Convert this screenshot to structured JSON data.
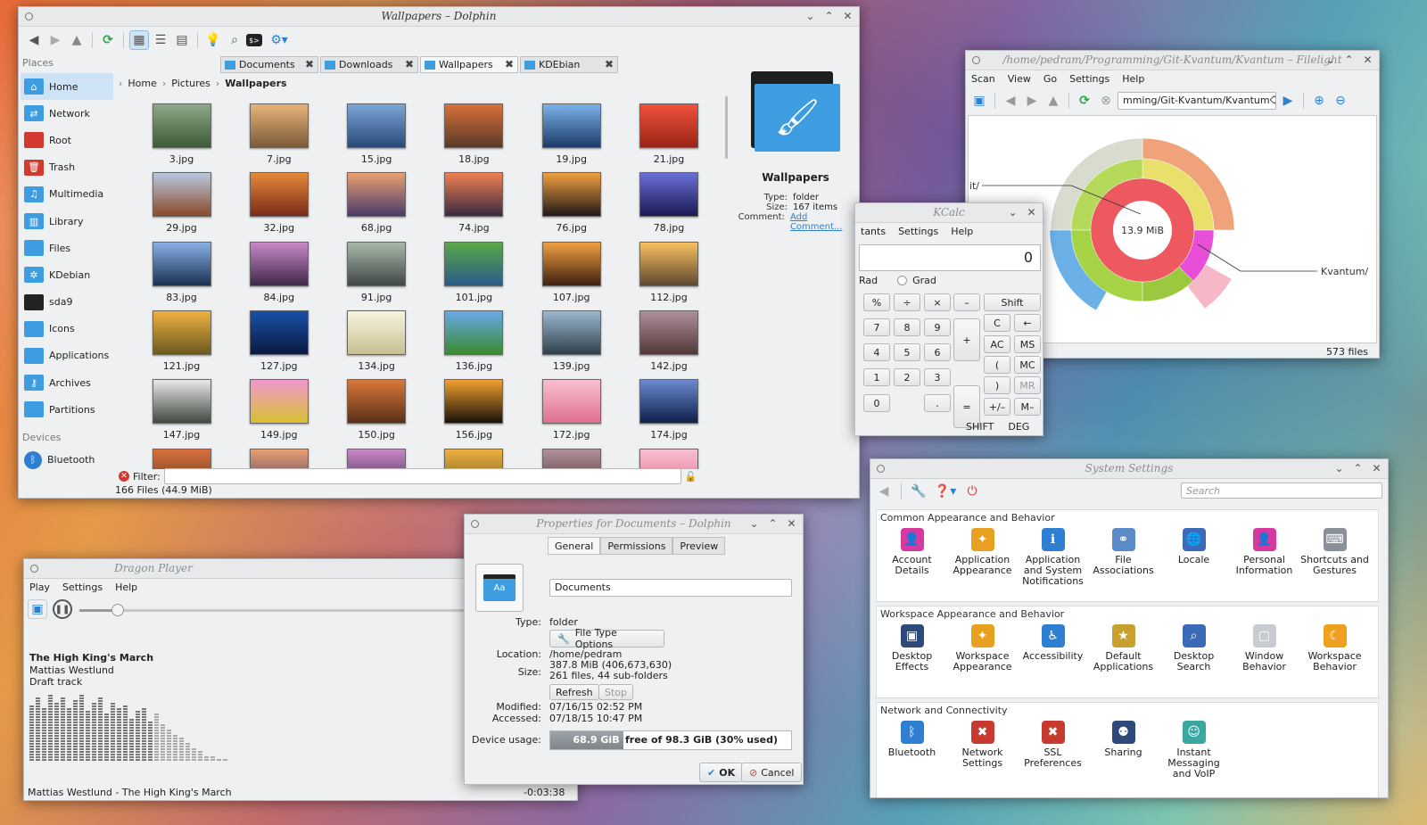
{
  "dolphin": {
    "title": "Wallpapers – Dolphin",
    "places_header": "Places",
    "devices_header": "Devices",
    "places": [
      "Home",
      "Network",
      "Root",
      "Trash",
      "Multimedia",
      "Library",
      "Files",
      "KDebian",
      "sda9",
      "Icons",
      "Applications",
      "Archives",
      "Partitions"
    ],
    "devices": [
      "Bluetooth"
    ],
    "tabs": [
      "Documents",
      "Downloads",
      "Wallpapers",
      "KDEbian"
    ],
    "breadcrumb": [
      "Home",
      "Pictures",
      "Wallpapers"
    ],
    "files": [
      "3.jpg",
      "7.jpg",
      "15.jpg",
      "18.jpg",
      "19.jpg",
      "21.jpg",
      "29.jpg",
      "32.jpg",
      "68.jpg",
      "74.jpg",
      "76.jpg",
      "78.jpg",
      "83.jpg",
      "84.jpg",
      "91.jpg",
      "101.jpg",
      "107.jpg",
      "112.jpg",
      "121.jpg",
      "127.jpg",
      "134.jpg",
      "136.jpg",
      "139.jpg",
      "142.jpg",
      "147.jpg",
      "149.jpg",
      "150.jpg",
      "156.jpg",
      "172.jpg",
      "174.jpg"
    ],
    "info": {
      "name": "Wallpapers",
      "type_label": "Type:",
      "type": "folder",
      "size_label": "Size:",
      "size": "167 items",
      "comment_label": "Comment:",
      "comment_link": "Add Comment..."
    },
    "filter_label": "Filter:",
    "status": "166 Files (44.9 MiB)"
  },
  "filelight": {
    "title": "/home/pedram/Programming/Git-Kvantum/Kvantum – Filelight",
    "menu": [
      "Scan",
      "View",
      "Go",
      "Settings",
      "Help"
    ],
    "path": "mming/Git-Kvantum/Kvantum",
    "center": "13.9 MiB",
    "label_git": ".git/",
    "label_kvantum": "Kvantum/",
    "status": "573 files"
  },
  "kcalc": {
    "title": "KCalc",
    "menu": [
      "tants",
      "Settings",
      "Help"
    ],
    "display": "0",
    "rad": "Rad",
    "grad": "Grad",
    "shift_label": "SHIFT",
    "deg_label": "DEG",
    "keys": [
      "%",
      "÷",
      "×",
      "–",
      "Shift",
      "7",
      "8",
      "9",
      "C",
      "←",
      "4",
      "5",
      "6",
      "+",
      "AC",
      "MS",
      "1",
      "2",
      "3",
      "(",
      "MC",
      ")",
      "MR",
      "0",
      ".",
      "=",
      "+/–",
      "M–"
    ]
  },
  "syssettings": {
    "title": "System Settings",
    "search_placeholder": "Search",
    "cat1": "Common Appearance and Behavior",
    "cat2": "Workspace Appearance and Behavior",
    "cat3": "Network and Connectivity",
    "items1": [
      "Account Details",
      "Application Appearance",
      "Application and System Notifications",
      "File Associations",
      "Locale",
      "Personal Information",
      "Shortcuts and Gestures"
    ],
    "items2": [
      "Desktop Effects",
      "Workspace Appearance",
      "Accessibility",
      "Default Applications",
      "Desktop Search",
      "Window Behavior",
      "Workspace Behavior"
    ],
    "items3": [
      "Bluetooth",
      "Network Settings",
      "SSL Preferences",
      "Sharing",
      "Instant Messaging and VoIP"
    ]
  },
  "props": {
    "title": "Properties for Documents – Dolphin",
    "tabs": [
      "General",
      "Permissions",
      "Preview"
    ],
    "name": "Documents",
    "type_label": "Type:",
    "type": "folder",
    "filetype_btn": "File Type Options",
    "location_label": "Location:",
    "location": "/home/pedram",
    "size_label": "Size:",
    "size1": "387.8 MiB (406,673,630)",
    "size2": "261 files, 44 sub-folders",
    "refresh": "Refresh",
    "stop": "Stop",
    "modified_label": "Modified:",
    "modified": "07/16/15 02:52 PM",
    "accessed_label": "Accessed:",
    "accessed": "07/18/15 10:47 PM",
    "usage_label": "Device usage:",
    "usage_used": "68.9 GiB",
    "usage_text": "free of 98.3 GiB (30% used)",
    "usage_fraction": 0.3,
    "ok": "OK",
    "cancel": "Cancel"
  },
  "dragon": {
    "title": "Dragon Player",
    "menu": [
      "Play",
      "Settings",
      "Help"
    ],
    "track": "The High King's March",
    "artist": "Mattias Westlund",
    "album": "Draft track",
    "now_playing": "Mattias Westlund - The High King's March",
    "time": "-0:03:38",
    "progress": 0.2
  }
}
